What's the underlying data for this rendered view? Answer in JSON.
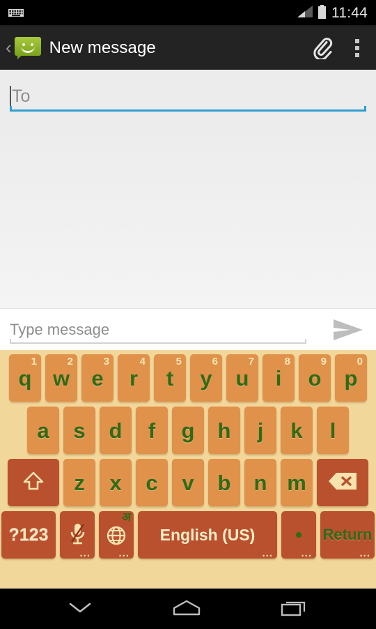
{
  "statusbar": {
    "ime_icon": "keyboard-icon",
    "signal_icon": "signal-bars-icon",
    "battery_icon": "battery-icon",
    "clock": "11:44"
  },
  "actionbar": {
    "back_icon": "back-chevron-icon",
    "app_icon": "messaging-bubble-icon",
    "title": "New message",
    "attach_icon": "paperclip-icon",
    "overflow_icon": "overflow-menu-icon"
  },
  "compose": {
    "to_placeholder": "To",
    "to_value": "",
    "message_placeholder": "Type message",
    "message_value": "",
    "send_icon": "send-arrow-icon"
  },
  "keyboard": {
    "row1": [
      {
        "label": "q",
        "hint": "1"
      },
      {
        "label": "w",
        "hint": "2"
      },
      {
        "label": "e",
        "hint": "3"
      },
      {
        "label": "r",
        "hint": "4"
      },
      {
        "label": "t",
        "hint": "5"
      },
      {
        "label": "y",
        "hint": "6"
      },
      {
        "label": "u",
        "hint": "7"
      },
      {
        "label": "i",
        "hint": "8"
      },
      {
        "label": "o",
        "hint": "9"
      },
      {
        "label": "p",
        "hint": "0"
      }
    ],
    "row2": [
      {
        "label": "a"
      },
      {
        "label": "s"
      },
      {
        "label": "d"
      },
      {
        "label": "f"
      },
      {
        "label": "g"
      },
      {
        "label": "h"
      },
      {
        "label": "j"
      },
      {
        "label": "k"
      },
      {
        "label": "l"
      }
    ],
    "row3": {
      "shift_icon": "shift-arrow-icon",
      "letters": [
        {
          "label": "z"
        },
        {
          "label": "x"
        },
        {
          "label": "c"
        },
        {
          "label": "v"
        },
        {
          "label": "b"
        },
        {
          "label": "n"
        },
        {
          "label": "m"
        }
      ],
      "backspace_icon": "backspace-icon"
    },
    "row4": {
      "symbols_label": "?123",
      "mic_icon": "microphone-muted-icon",
      "globe_icon": "language-globe-icon",
      "globe_hint": "अ",
      "space_label": "English (US)",
      "period_label": ".",
      "return_label": "Return",
      "longpress_hint": "..."
    },
    "colors": {
      "background": "#f2d79b",
      "letter_key": "#e0914a",
      "function_key": "#b9512f",
      "letter_text": "#2f6b15",
      "function_text": "#f7e9c0",
      "hint_text": "#f7e7b6"
    }
  },
  "navbar": {
    "back_icon": "hide-keyboard-chevron-icon",
    "home_icon": "home-icon",
    "recents_icon": "recent-apps-icon"
  }
}
